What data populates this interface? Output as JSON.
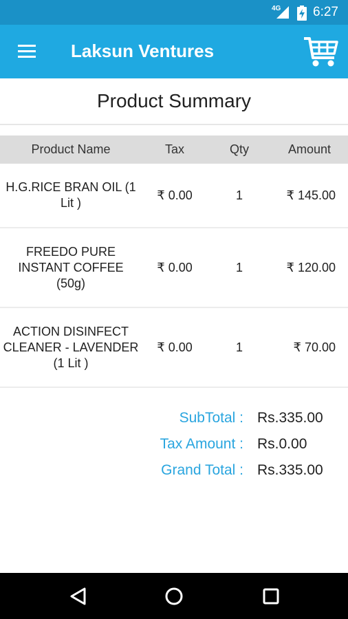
{
  "status_bar": {
    "network": "4G",
    "time": "6:27"
  },
  "app_bar": {
    "title": "Laksun Ventures",
    "menu_icon": "hamburger-menu-icon",
    "cart_icon": "shopping-cart-icon"
  },
  "page": {
    "title": "Product Summary"
  },
  "table": {
    "headers": {
      "name": "Product Name",
      "tax": "Tax",
      "qty": "Qty",
      "amount": "Amount"
    },
    "rows": [
      {
        "name": "H.G.RICE BRAN OIL   (1 Lit )",
        "tax": "₹ 0.00",
        "qty": "1",
        "amount": "₹ 145.00"
      },
      {
        "name": "FREEDO PURE INSTANT COFFEE (50g)",
        "tax": "₹ 0.00",
        "qty": "1",
        "amount": "₹ 120.00"
      },
      {
        "name": "ACTION DISINFECT CLEANER - LAVENDER (1 Lit )",
        "tax": "₹ 0.00",
        "qty": "1",
        "amount": "₹ 70.00"
      }
    ]
  },
  "totals": {
    "subtotal_label": "SubTotal :",
    "subtotal_value": "Rs.335.00",
    "tax_label": "Tax Amount :",
    "tax_value": "Rs.0.00",
    "grand_label": "Grand Total :",
    "grand_value": "Rs.335.00"
  },
  "colors": {
    "app_bar": "#1fa9e1",
    "status_bar": "#1a91c7",
    "label_accent": "#29a5df",
    "table_header_bg": "#dcdcdc"
  },
  "nav_bar": {
    "back_icon": "back-triangle-icon",
    "home_icon": "home-circle-icon",
    "recents_icon": "recents-square-icon"
  }
}
